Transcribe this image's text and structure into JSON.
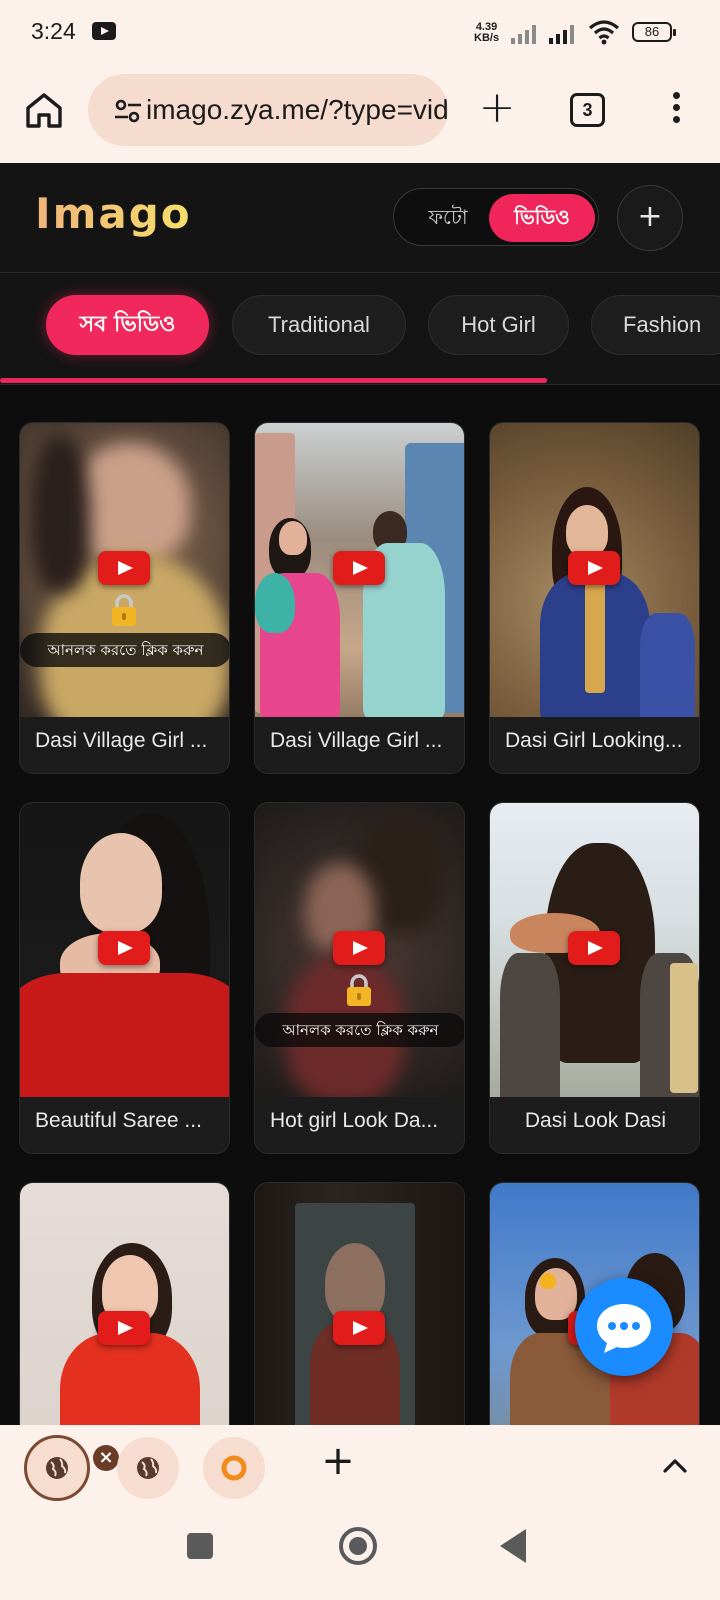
{
  "status_bar": {
    "time": "3:24",
    "net_speed_value": "4.39",
    "net_speed_unit": "KB/s",
    "battery": "86"
  },
  "browser": {
    "url": "imago.zya.me/?type=video",
    "tab_count": "3"
  },
  "app": {
    "logo": "Imago",
    "toggle": {
      "photo_label": "ফটো",
      "video_label": "ভিডিও",
      "active": "video"
    },
    "add_label": "+"
  },
  "categories": {
    "items": [
      {
        "label": "সব ভিডিও",
        "active": true
      },
      {
        "label": "Traditional",
        "active": false
      },
      {
        "label": "Hot Girl",
        "active": false
      },
      {
        "label": "Fashion",
        "active": false
      }
    ],
    "scroll_progress": 0.76
  },
  "videos": [
    {
      "title": "Dasi Village Girl ...",
      "locked": true,
      "unlock_text": "আনলক করতে ক্লিক করুন"
    },
    {
      "title": "Dasi Village Girl ...",
      "locked": false
    },
    {
      "title": "Dasi Girl Looking...",
      "locked": false
    },
    {
      "title": "Beautiful Saree ...",
      "locked": false
    },
    {
      "title": "Hot girl Look Da...",
      "locked": true,
      "unlock_text": "আনলক করতে ক্লিক করুন"
    },
    {
      "title": "Dasi Look Dasi",
      "locked": false
    },
    {
      "title": "",
      "locked": false
    },
    {
      "title": "",
      "locked": false
    },
    {
      "title": "",
      "locked": false
    }
  ],
  "tab_strip": {
    "tabs": [
      "globe-icon",
      "globe-icon",
      "ring-icon"
    ],
    "close_label": "×"
  },
  "colors": {
    "accent": "#f0285b",
    "chat_fab": "#1a8cff",
    "youtube_red": "#e21b1b"
  }
}
